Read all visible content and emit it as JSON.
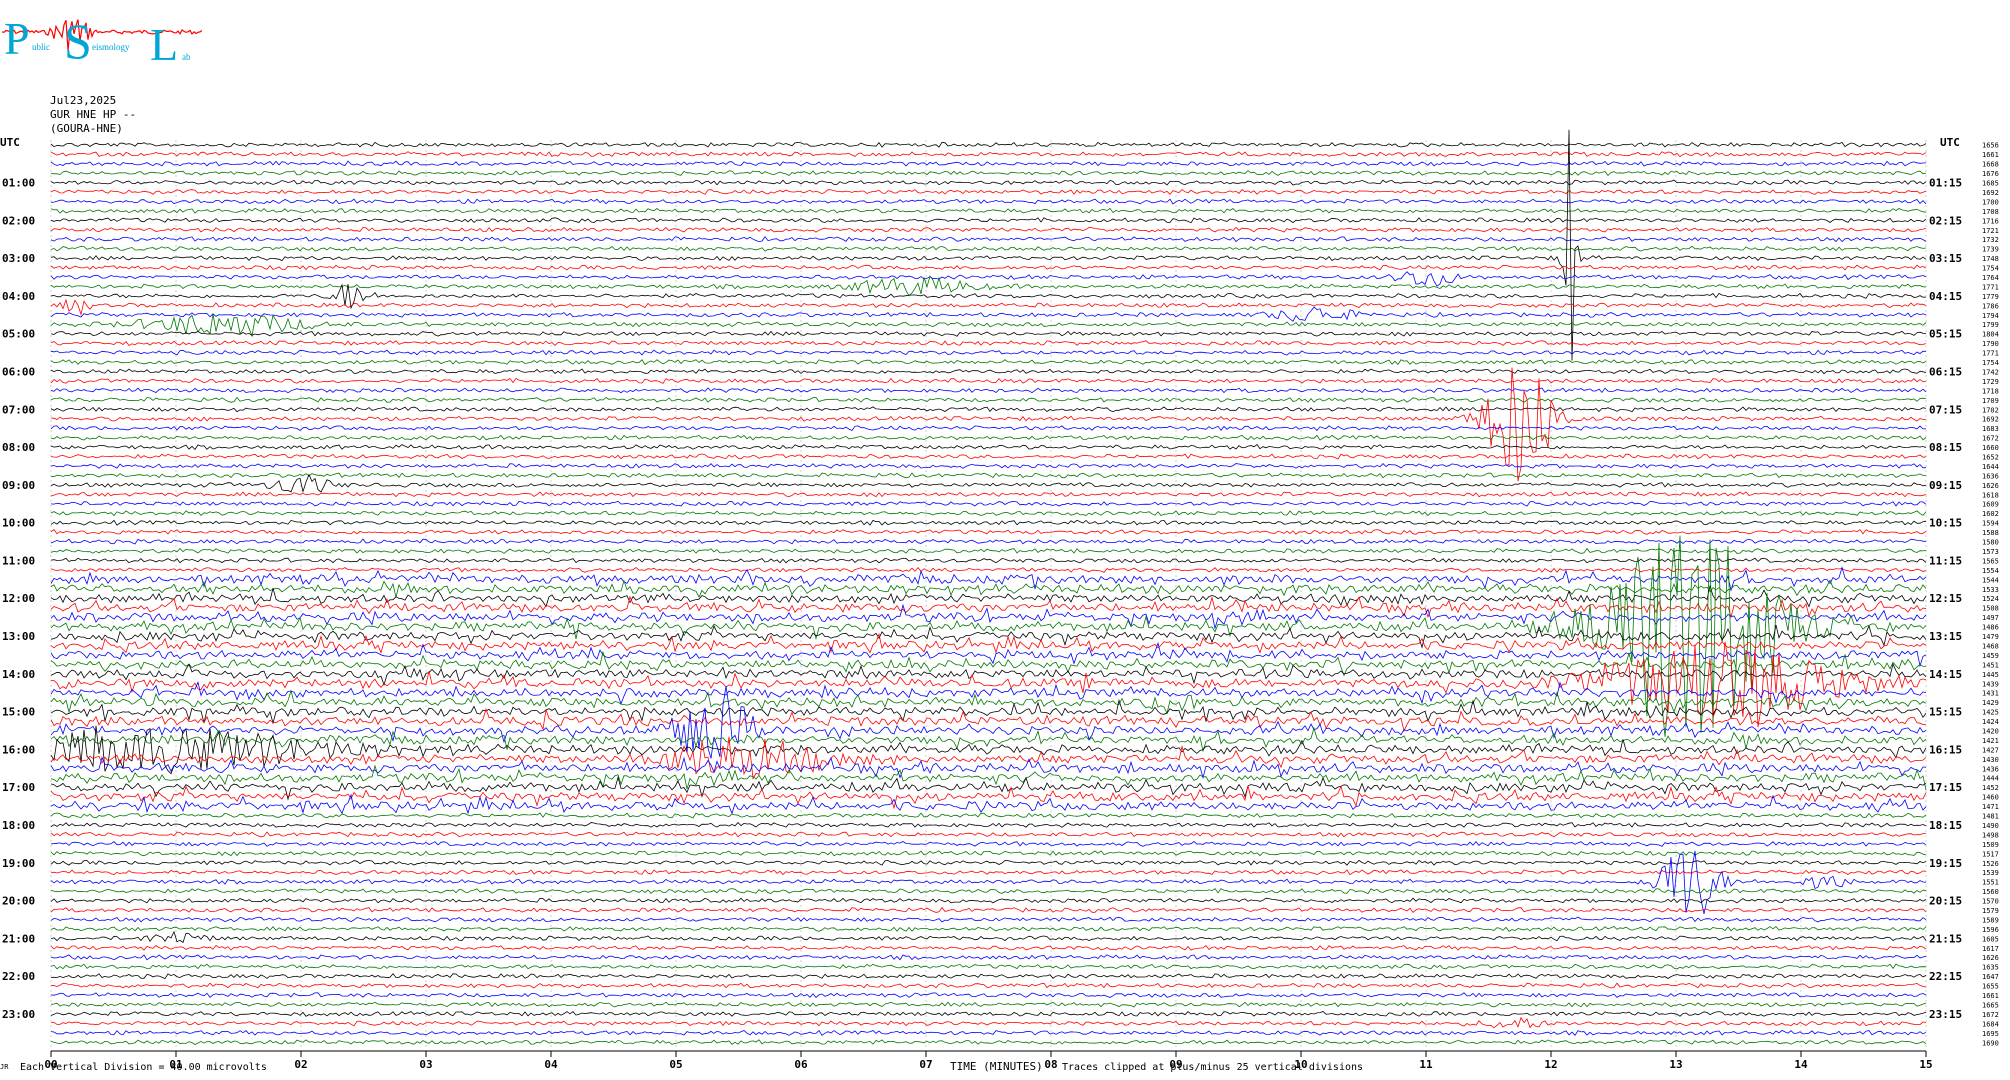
{
  "logo": {
    "letters": [
      "P",
      "S",
      "L"
    ],
    "subwords": [
      "ublic",
      "eismology",
      "ab"
    ],
    "color": "#00a6d6",
    "wave_color": "#ff0000"
  },
  "header": {
    "date": "Jul23,2025",
    "channel": "GUR HNE HP --",
    "station": "(GOURA-HNE)"
  },
  "footer": {
    "division": "Each Vertical Division =   40.00 microvolts",
    "clip": "Traces clipped at plus/minus 25 vertical divisions",
    "corner": "JR"
  },
  "colors": [
    "#000000",
    "#ff0000",
    "#0000ff",
    "#007700"
  ],
  "chart_data": {
    "type": "line",
    "title": "",
    "xlabel": "TIME (MINUTES)",
    "left_axis_label": "UTC",
    "right_axis_label": "UTC",
    "x_ticks": [
      "00",
      "01",
      "02",
      "03",
      "04",
      "05",
      "06",
      "07",
      "08",
      "09",
      "10",
      "11",
      "12",
      "13",
      "14",
      "15"
    ],
    "xlim": [
      0,
      15
    ],
    "rows": 96,
    "left_labels": [
      "01:00",
      "02:00",
      "03:00",
      "04:00",
      "05:00",
      "06:00",
      "07:00",
      "08:00",
      "09:00",
      "10:00",
      "11:00",
      "12:00",
      "13:00",
      "14:00",
      "15:00",
      "16:00",
      "17:00",
      "18:00",
      "19:00",
      "20:00",
      "21:00",
      "22:00",
      "23:00"
    ],
    "right_labels": [
      "01:15",
      "02:15",
      "03:15",
      "04:15",
      "05:15",
      "06:15",
      "07:15",
      "08:15",
      "09:15",
      "10:15",
      "11:15",
      "12:15",
      "13:15",
      "14:15",
      "15:15",
      "16:15",
      "17:15",
      "18:15",
      "19:15",
      "20:15",
      "21:15",
      "22:15",
      "23:15"
    ],
    "right_values": [
      1656,
      1661,
      1668,
      1676,
      1685,
      1692,
      1700,
      1708,
      1716,
      1721,
      1732,
      1739,
      1748,
      1754,
      1764,
      1771,
      1779,
      1786,
      1794,
      1799,
      1804,
      1790,
      1771,
      1754,
      1742,
      1729,
      1718,
      1709,
      1702,
      1692,
      1683,
      1672,
      1660,
      1652,
      1644,
      1636,
      1626,
      1618,
      1609,
      1602,
      1594,
      1588,
      1580,
      1573,
      1565,
      1554,
      1544,
      1533,
      1524,
      1508,
      1497,
      1486,
      1479,
      1468,
      1459,
      1451,
      1445,
      1439,
      1431,
      1429,
      1425,
      1424,
      1420,
      1421,
      1427,
      1430,
      1436,
      1444,
      1452,
      1460,
      1471,
      1481,
      1490,
      1498,
      1509,
      1517,
      1526,
      1539,
      1551,
      1560,
      1570,
      1579,
      1589,
      1596,
      1605,
      1617,
      1626,
      1635,
      1647,
      1655,
      1661,
      1665,
      1672,
      1684,
      1695,
      1690
    ],
    "events": [
      {
        "row": 16,
        "minute": 2.4,
        "amp": 14,
        "width": 0.18,
        "color": "#000000"
      },
      {
        "row": 17,
        "minute": 0.2,
        "amp": 10,
        "width": 0.12,
        "color": "#ff0000"
      },
      {
        "row": 19,
        "minute": 1.4,
        "amp": 12,
        "width": 0.8,
        "color": "#000000"
      },
      {
        "row": 15,
        "minute": 6.9,
        "amp": 9,
        "width": 0.6,
        "color": "#000000"
      },
      {
        "row": 14,
        "minute": 11.0,
        "amp": 10,
        "width": 0.3,
        "color": "#007700"
      },
      {
        "row": 18,
        "minute": 10.1,
        "amp": 8,
        "width": 0.4,
        "color": "#0000ff"
      },
      {
        "row": 29,
        "minute": 11.75,
        "amp": 70,
        "width": 0.35,
        "color": "#000000"
      },
      {
        "row": 12,
        "minute": 12.15,
        "amp": 180,
        "width": 0.06,
        "color": "#ff0000"
      },
      {
        "row": 36,
        "minute": 2.0,
        "amp": 10,
        "width": 0.3,
        "color": "#0000ff"
      },
      {
        "row": 51,
        "minute": 13.1,
        "amp": 120,
        "width": 0.9,
        "color": "#ff0000"
      },
      {
        "row": 57,
        "minute": 13.3,
        "amp": 40,
        "width": 1.3,
        "color": "#ff0000"
      },
      {
        "row": 59,
        "minute": 9.0,
        "amp": 12,
        "width": 0.25,
        "color": "#000000"
      },
      {
        "row": 62,
        "minute": 5.3,
        "amp": 45,
        "width": 0.4,
        "color": "#000000"
      },
      {
        "row": 64,
        "minute": 0.8,
        "amp": 20,
        "width": 1.8,
        "color": "#0000ff"
      },
      {
        "row": 65,
        "minute": 5.5,
        "amp": 20,
        "width": 0.8,
        "color": "#007700"
      },
      {
        "row": 78,
        "minute": 13.1,
        "amp": 45,
        "width": 0.3,
        "color": "#ff0000"
      },
      {
        "row": 78,
        "minute": 14.2,
        "amp": 10,
        "width": 0.2,
        "color": "#007700"
      },
      {
        "row": 84,
        "minute": 1.0,
        "amp": 6,
        "width": 0.3,
        "color": "#000000"
      },
      {
        "row": 93,
        "minute": 11.7,
        "amp": 6,
        "width": 0.3,
        "color": "#007700"
      }
    ],
    "noisy_rows": [
      46,
      70
    ],
    "grid": true
  }
}
